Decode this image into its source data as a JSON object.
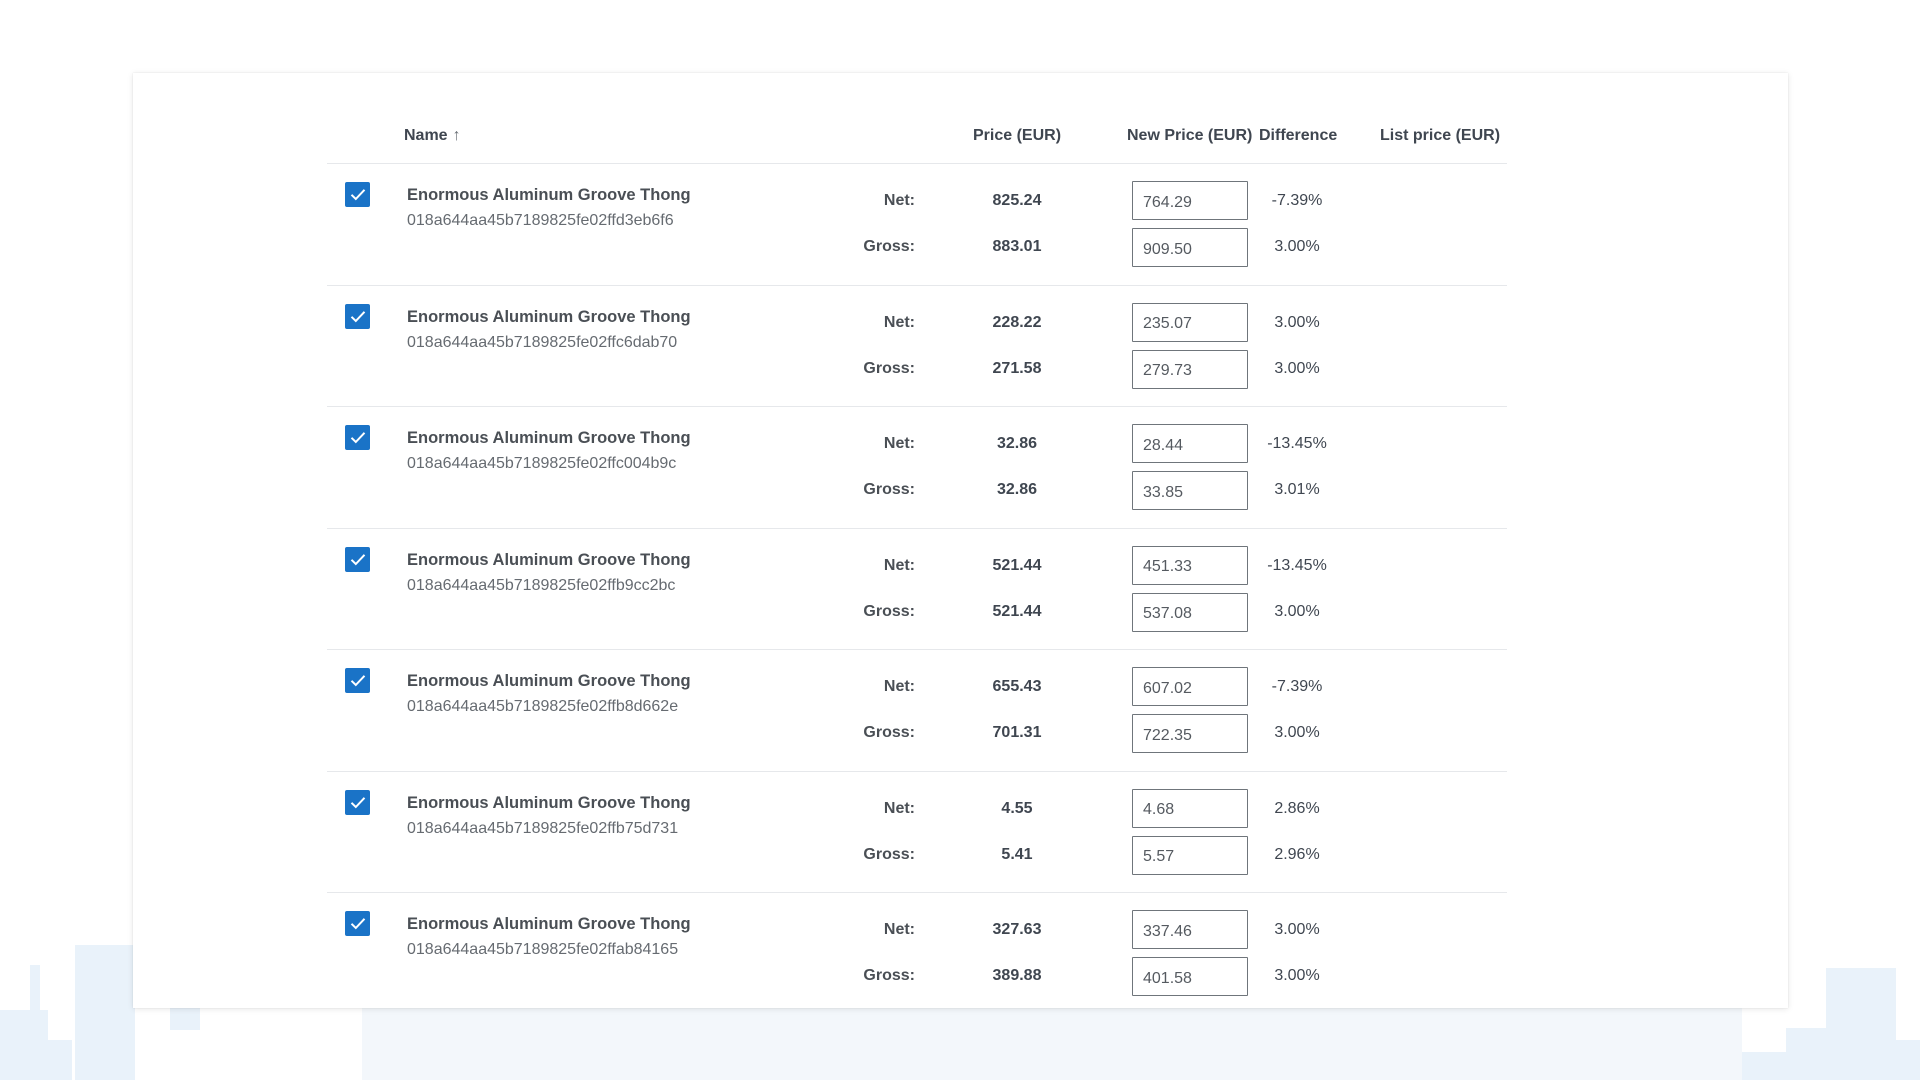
{
  "header": {
    "name": "Name",
    "sort_icon": "↑",
    "price": "Price (EUR)",
    "new_price": "New Price (EUR)",
    "difference": "Difference",
    "list_price": "List price (EUR)"
  },
  "labels": {
    "net": "Net:",
    "gross": "Gross:"
  },
  "rows": [
    {
      "checked": true,
      "name": "Enormous Aluminum Groove Thong",
      "id": "018a644aa45b7189825fe02ffd3eb6f6",
      "net_price": "825.24",
      "gross_price": "883.01",
      "new_net": "764.29",
      "new_gross": "909.50",
      "diff_net": "-7.39%",
      "diff_gross": "3.00%"
    },
    {
      "checked": true,
      "name": "Enormous Aluminum Groove Thong",
      "id": "018a644aa45b7189825fe02ffc6dab70",
      "net_price": "228.22",
      "gross_price": "271.58",
      "new_net": "235.07",
      "new_gross": "279.73",
      "diff_net": "3.00%",
      "diff_gross": "3.00%"
    },
    {
      "checked": true,
      "name": "Enormous Aluminum Groove Thong",
      "id": "018a644aa45b7189825fe02ffc004b9c",
      "net_price": "32.86",
      "gross_price": "32.86",
      "new_net": "28.44",
      "new_gross": "33.85",
      "diff_net": "-13.45%",
      "diff_gross": "3.01%"
    },
    {
      "checked": true,
      "name": "Enormous Aluminum Groove Thong",
      "id": "018a644aa45b7189825fe02ffb9cc2bc",
      "net_price": "521.44",
      "gross_price": "521.44",
      "new_net": "451.33",
      "new_gross": "537.08",
      "diff_net": "-13.45%",
      "diff_gross": "3.00%"
    },
    {
      "checked": true,
      "name": "Enormous Aluminum Groove Thong",
      "id": "018a644aa45b7189825fe02ffb8d662e",
      "net_price": "655.43",
      "gross_price": "701.31",
      "new_net": "607.02",
      "new_gross": "722.35",
      "diff_net": "-7.39%",
      "diff_gross": "3.00%"
    },
    {
      "checked": true,
      "name": "Enormous Aluminum Groove Thong",
      "id": "018a644aa45b7189825fe02ffb75d731",
      "net_price": "4.55",
      "gross_price": "5.41",
      "new_net": "4.68",
      "new_gross": "5.57",
      "diff_net": "2.86%",
      "diff_gross": "2.96%"
    },
    {
      "checked": true,
      "name": "Enormous Aluminum Groove Thong",
      "id": "018a644aa45b7189825fe02ffab84165",
      "net_price": "327.63",
      "gross_price": "389.88",
      "new_net": "337.46",
      "new_gross": "401.58",
      "diff_net": "3.00%",
      "diff_gross": "3.00%"
    }
  ],
  "colors": {
    "accent": "#1a73c7",
    "border": "#e6e8eb",
    "skyline": "#e9f2fa"
  },
  "icons": {
    "checkbox": "checkmark-icon",
    "sort": "sort-ascending-icon"
  }
}
